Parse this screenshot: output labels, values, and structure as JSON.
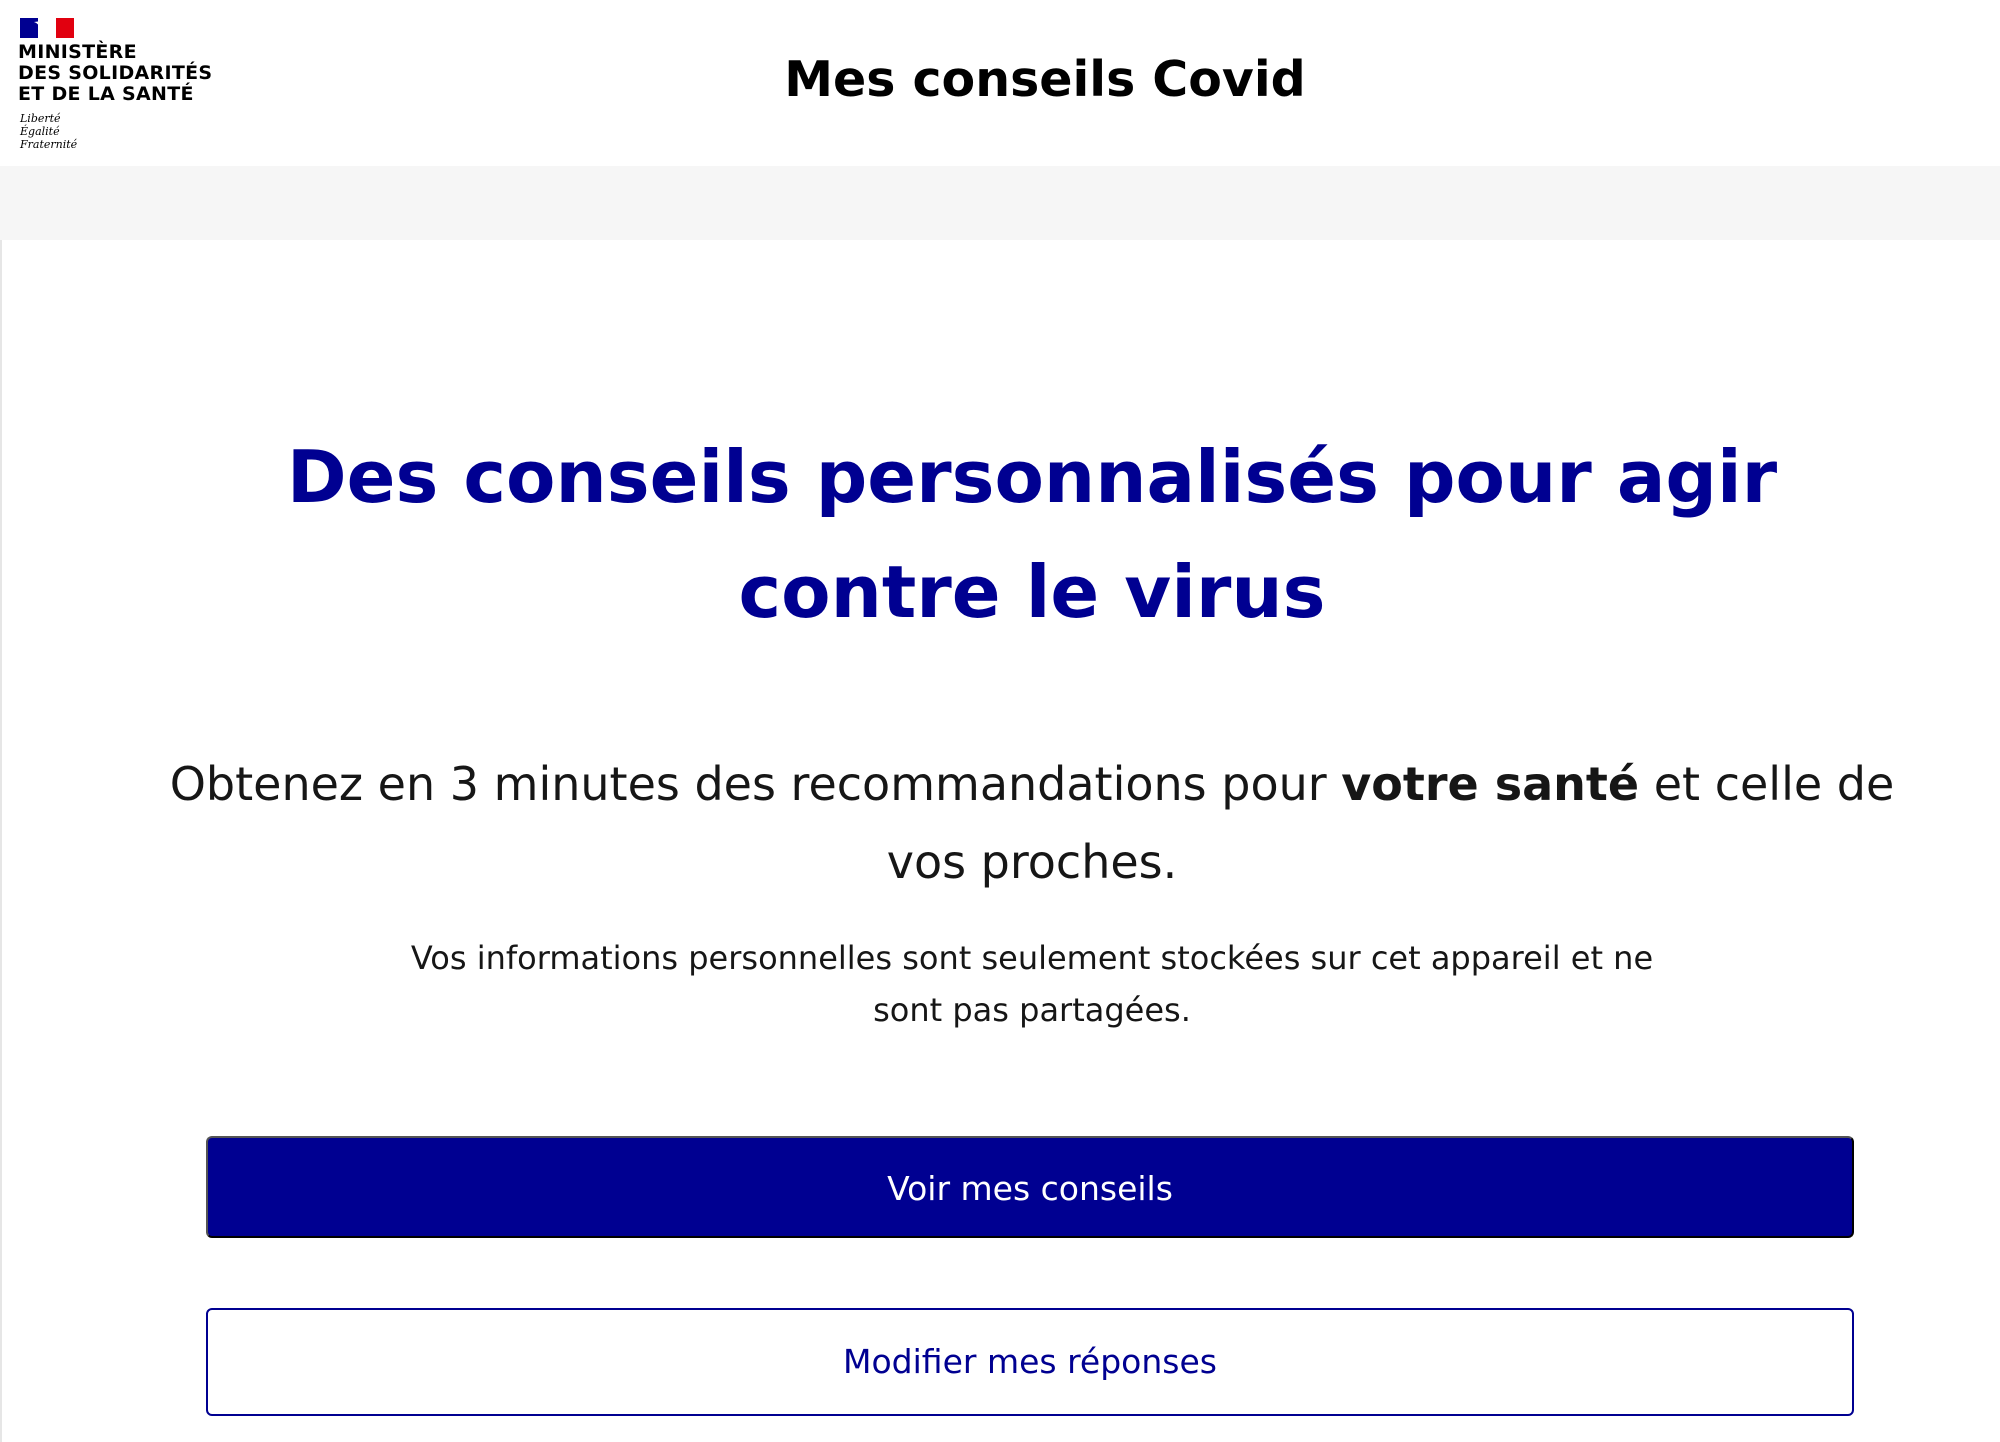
{
  "colors": {
    "accent": "#000091",
    "band": "#f6f6f6",
    "text": "#161616",
    "flag_blue": "#000091",
    "flag_white": "#ffffff",
    "flag_red": "#e1000f"
  },
  "header": {
    "logo": {
      "icon": "marianne-flag-icon",
      "lines": [
        "MINISTÈRE",
        "DES SOLIDARITÉS",
        "ET DE LA SANTÉ"
      ],
      "motto": [
        "Liberté",
        "Égalité",
        "Fraternité"
      ]
    },
    "site_title": "Mes conseils Covid"
  },
  "main": {
    "hero_title": "Des conseils personnalisés pour agir contre le virus",
    "intro": {
      "before": "Obtenez en 3 minutes des recommandations pour ",
      "bold": "votre santé",
      "after": " et celle de vos proches."
    },
    "privacy_note": "Vos informations personnelles sont seulement stockées sur cet appareil et ne sont pas partagées.",
    "primary_button": "Voir mes conseils",
    "secondary_button": "Modifier mes réponses"
  }
}
